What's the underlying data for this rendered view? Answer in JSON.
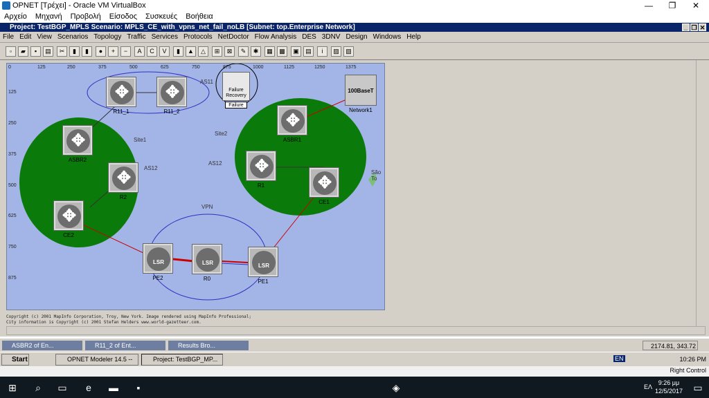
{
  "vbox": {
    "title": "OPNET [Τρέχει] - Oracle VM VirtualBox",
    "menu": [
      "Αρχείο",
      "Μηχανή",
      "Προβολή",
      "Είσοδος",
      "Συσκευές",
      "Βοήθεια"
    ],
    "status_right": "Right Control"
  },
  "project": {
    "title": "Project: TestBGP_MPLS Scenario: MPLS_CE_with_vpns_net_fail_noLB [Subnet: top.Enterprise Network]",
    "menu": [
      "File",
      "Edit",
      "View",
      "Scenarios",
      "Topology",
      "Traffic",
      "Services",
      "Protocols",
      "NetDoctor",
      "Flow Analysis",
      "DES",
      "3DNV",
      "Design",
      "Windows",
      "Help"
    ]
  },
  "map": {
    "x_ticks": [
      "0",
      "125",
      "250",
      "375",
      "500",
      "625",
      "750",
      "875",
      "1000",
      "1125",
      "1250",
      "1375"
    ],
    "y_ticks": [
      "125",
      "250",
      "375",
      "500",
      "625",
      "750",
      "875"
    ],
    "zones": {
      "as11": "AS11",
      "site1": "Site1",
      "as12_left": "AS12",
      "site2": "Site2",
      "as12_mid": "AS12",
      "vpn": "VPN",
      "sao": "São To"
    },
    "nodes": {
      "r11_1": "R11_1",
      "r11_2": "R11_2",
      "asbr2": "ASBR2",
      "r2": "R2",
      "ce2": "CE2",
      "asbr1": "ASBR1",
      "r1": "R1",
      "ce1": "CE1",
      "pe2": "PE2",
      "r0": "R0",
      "pe1": "PE1",
      "failure": "Failure",
      "failure_icon": "Failure Recovery",
      "network1": "Network1",
      "hub_text": "100BaseT"
    },
    "lsr": "LSR",
    "copyright": "Copyright (c) 2001 MapInfo Corporation, Troy, New York. Image rendered using MapInfo Professional;\nCity information is Copyright (c) 2001 Stefan Helders www.world-gazetteer.com."
  },
  "status": {
    "windows": [
      "ASBR2 of En...",
      "R11_2 of Ent...",
      "Results Bro..."
    ],
    "coords": "2174.81, 343.72"
  },
  "guest_taskbar": {
    "start": "Start",
    "tasks": [
      "OPNET Modeler 14.5 -- E...",
      "Project: TestBGP_MP..."
    ],
    "lang": "EN",
    "clock": "10:26 PM"
  },
  "host_taskbar": {
    "time": "9:26 μμ",
    "date": "12/5/2017",
    "lang": "ΕΛ"
  },
  "colors": {
    "titlebar": "#0a246a",
    "map_bg": "#a3b4e6",
    "site_green": "#0a7a0a",
    "link_red": "#cc0000",
    "link_blue": "#3030c0"
  }
}
